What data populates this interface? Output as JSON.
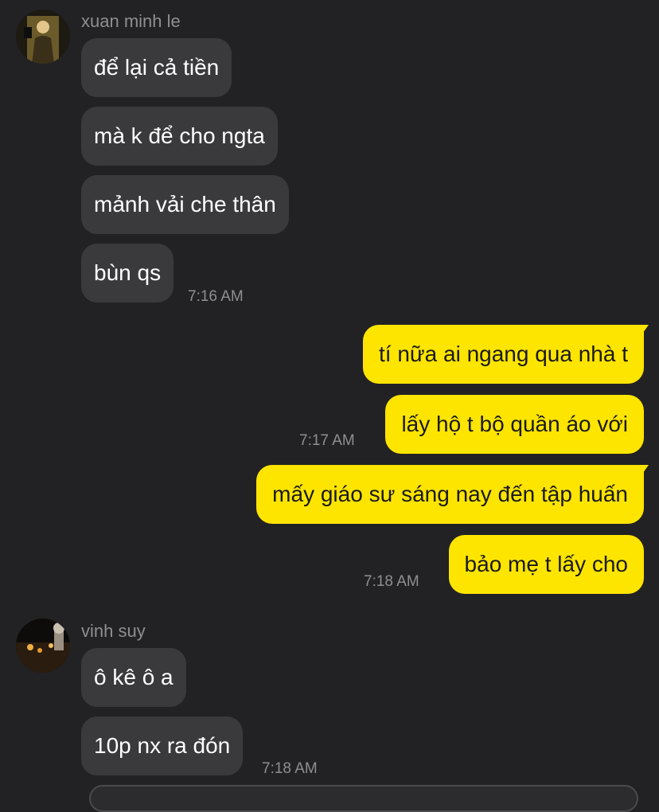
{
  "groups": [
    {
      "sender": "xuan minh le",
      "avatar_icon": "profile-photo",
      "messages": [
        "để lại cả tiền",
        "mà k để cho ngta",
        "mảnh vải che thân",
        "bùn qs"
      ],
      "time": "7:16 AM"
    },
    {
      "sender_self": true,
      "messages": [
        "tí nữa ai ngang qua nhà t",
        "lấy hộ t bộ quần áo với"
      ],
      "time": "7:17 AM"
    },
    {
      "sender_self": true,
      "messages": [
        "mấy giáo sư sáng nay đến tập huấn",
        "bảo mẹ t lấy cho"
      ],
      "time": "7:18 AM"
    },
    {
      "sender": "vinh suy",
      "avatar_icon": "profile-photo",
      "messages": [
        "ô kê ô a",
        "10p nx ra đón"
      ],
      "time": "7:18 AM"
    }
  ],
  "colors": {
    "background": "#222224",
    "incoming_bubble": "#3a3a3c",
    "outgoing_bubble": "#fee500",
    "timestamp": "#8e8e93"
  }
}
